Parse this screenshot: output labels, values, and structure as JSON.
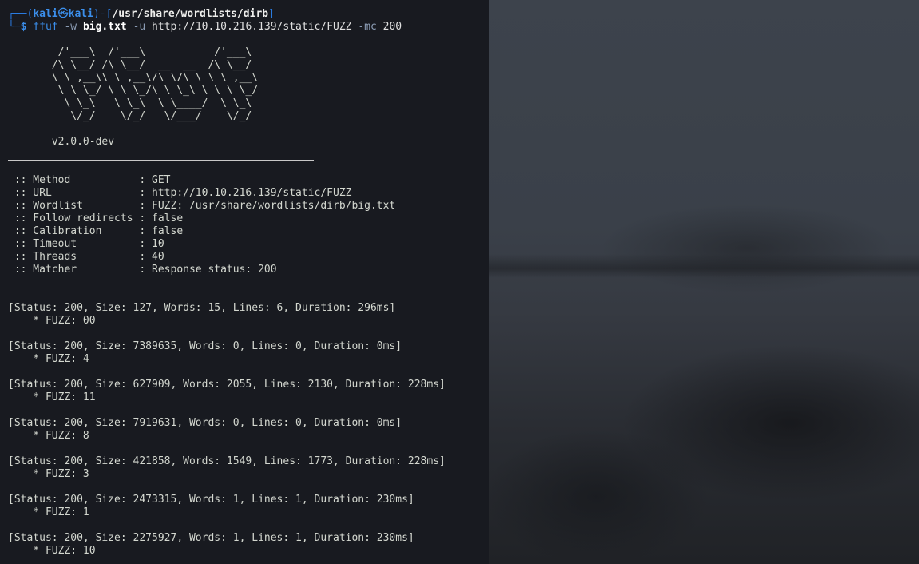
{
  "prompt": {
    "frame_open": "┌──(",
    "user": "kali",
    "at_symbol": "㉿",
    "host": "kali",
    "frame_mid": ")-[",
    "path": "/usr/share/wordlists/dirb",
    "frame_close": "]",
    "corner": "└─",
    "dollar": "$"
  },
  "command": {
    "name": "ffuf",
    "flag_w": "-w",
    "wordlist": "big.txt",
    "flag_u": "-u",
    "url": "http://10.10.216.139/static/FUZZ",
    "flag_mc": "-mc",
    "code": "200"
  },
  "banner": {
    "ascii_lines": [
      "        /'___\\  /'___\\           /'___\\       ",
      "       /\\ \\__/ /\\ \\__/  __  __  /\\ \\__/       ",
      "       \\ \\ ,__\\\\ \\ ,__\\/\\ \\/\\ \\ \\ \\ ,__\\      ",
      "        \\ \\ \\_/ \\ \\ \\_/\\ \\ \\_\\ \\ \\ \\ \\_/      ",
      "         \\ \\_\\   \\ \\_\\  \\ \\____/  \\ \\_\\       ",
      "          \\/_/    \\/_/   \\/___/    \\/_/       "
    ],
    "version": "       v2.0.0-dev"
  },
  "config": [
    {
      "text": " :: Method           : GET"
    },
    {
      "text": " :: URL              : http://10.10.216.139/static/FUZZ"
    },
    {
      "text": " :: Wordlist         : FUZZ: /usr/share/wordlists/dirb/big.txt"
    },
    {
      "text": " :: Follow redirects : false"
    },
    {
      "text": " :: Calibration      : false"
    },
    {
      "text": " :: Timeout          : 10"
    },
    {
      "text": " :: Threads          : 40"
    },
    {
      "text": " :: Matcher          : Response status: 200"
    }
  ],
  "results": [
    {
      "status": "[Status: 200, Size: 127, Words: 15, Lines: 6, Duration: 296ms]",
      "fuzz": "    * FUZZ: 00"
    },
    {
      "status": "[Status: 200, Size: 7389635, Words: 0, Lines: 0, Duration: 0ms]",
      "fuzz": "    * FUZZ: 4"
    },
    {
      "status": "[Status: 200, Size: 627909, Words: 2055, Lines: 2130, Duration: 228ms]",
      "fuzz": "    * FUZZ: 11"
    },
    {
      "status": "[Status: 200, Size: 7919631, Words: 0, Lines: 0, Duration: 0ms]",
      "fuzz": "    * FUZZ: 8"
    },
    {
      "status": "[Status: 200, Size: 421858, Words: 1549, Lines: 1773, Duration: 228ms]",
      "fuzz": "    * FUZZ: 3"
    },
    {
      "status": "[Status: 200, Size: 2473315, Words: 1, Lines: 1, Duration: 230ms]",
      "fuzz": "    * FUZZ: 1"
    },
    {
      "status": "[Status: 200, Size: 2275927, Words: 1, Lines: 1, Duration: 230ms]",
      "fuzz": "    * FUZZ: 10"
    }
  ],
  "colors": {
    "terminal_bg": "#181a20",
    "prompt_blue": "#3b8eea",
    "text": "#d3d7cf"
  }
}
